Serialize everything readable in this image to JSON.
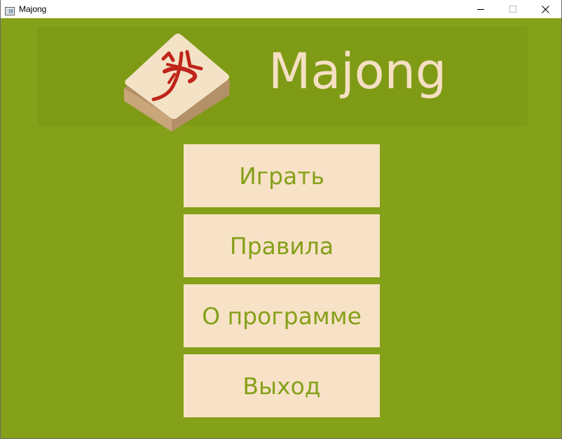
{
  "window": {
    "title": "Majong",
    "colors": {
      "background": "#85a019",
      "banner": "#7f9b16",
      "button": "#f8e2c7",
      "button_text": "#85a019",
      "logo_text": "#f6e0c4",
      "tile_symbol": "#c0241a"
    },
    "icons": [
      "app-icon",
      "minimize-icon",
      "maximize-icon",
      "close-icon"
    ]
  },
  "header": {
    "logo_text": "Majong",
    "tile_icon": "mahjong-tile-icon"
  },
  "menu": {
    "items": [
      {
        "label": "Играть"
      },
      {
        "label": "Правила"
      },
      {
        "label": "О программе"
      },
      {
        "label": "Выход"
      }
    ]
  }
}
